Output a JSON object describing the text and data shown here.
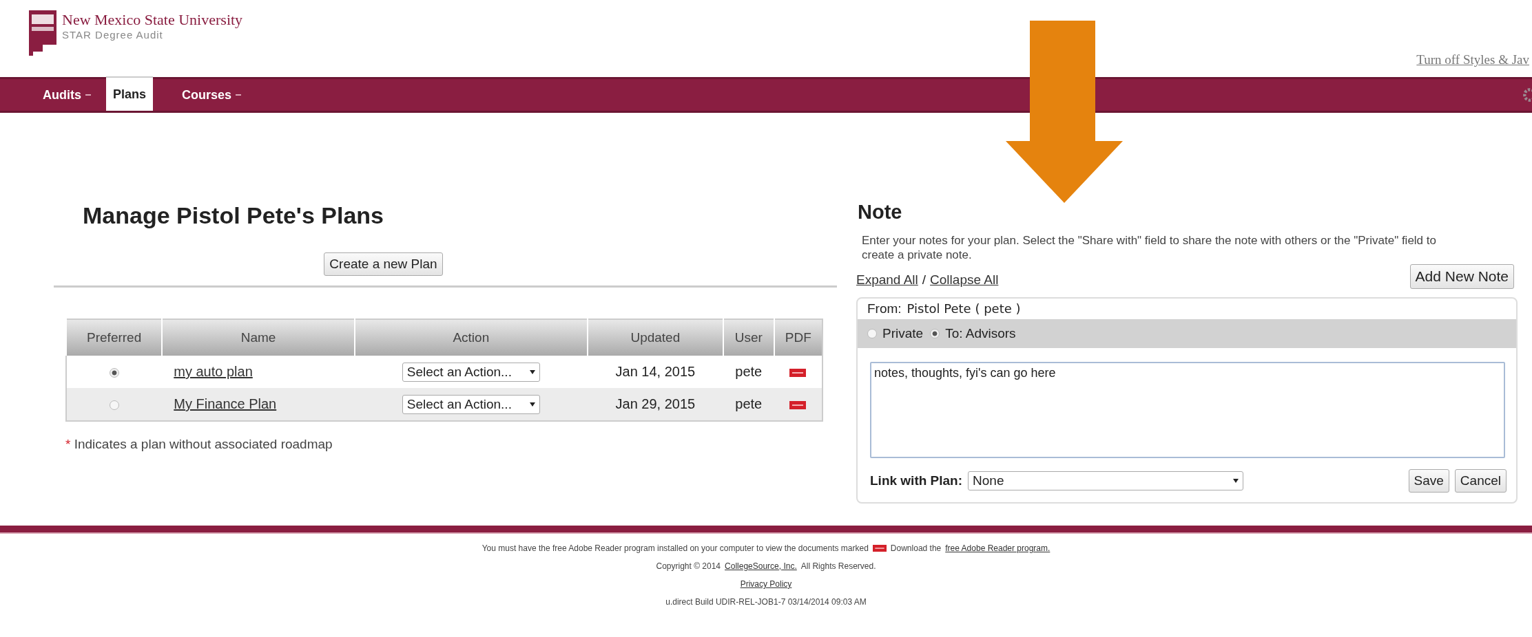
{
  "header": {
    "university": "New Mexico State University",
    "app_name": "STAR Degree Audit",
    "styles_link": "Turn off Styles & Jav"
  },
  "nav": [
    {
      "label": "Audits",
      "selected": false,
      "dropdown": true
    },
    {
      "label": "Plans",
      "selected": true,
      "dropdown": false
    },
    {
      "label": "Courses",
      "selected": false,
      "dropdown": true
    }
  ],
  "plans": {
    "title": "Manage Pistol Pete's Plans",
    "create_button": "Create a new Plan",
    "table": {
      "columns": [
        "Preferred",
        "Name",
        "Action",
        "Updated",
        "User",
        "PDF"
      ],
      "rows": [
        {
          "selected": true,
          "name": "my auto plan",
          "action": "Select an Action...",
          "updated": "Jan 14, 2015",
          "user": "pete"
        },
        {
          "selected": false,
          "name": "My Finance Plan",
          "action": "Select an Action...",
          "updated": "Jan 29, 2015",
          "user": "pete"
        }
      ]
    },
    "footnote_mark": "*",
    "footnote": "Indicates a plan without associated roadmap"
  },
  "note": {
    "title": "Note",
    "description": "Enter your notes for your plan. Select the \"Share with\" field to share the note with others or the \"Private\" field to create a private note.",
    "expand_all": "Expand All",
    "separator": "/",
    "collapse_all": "Collapse All",
    "add_button": "Add New Note",
    "from_label": "From:",
    "from_value": "Pistol Pete ( pete  )",
    "visibility": [
      {
        "label": "Private",
        "selected": false
      },
      {
        "label": "To: Advisors",
        "selected": true
      }
    ],
    "text": "notes, thoughts, fyi's can go here",
    "link_label": "Link with Plan:",
    "link_value": "None",
    "save_button": "Save",
    "cancel_button": "Cancel"
  },
  "footer": {
    "reader_text": "You must have the free Adobe Reader program installed on your computer to view the documents marked",
    "download_text": "Download the",
    "reader_link": "free Adobe Reader program.",
    "copyright_text": "Copyright © 2014",
    "company_link": "CollegeSource, Inc.",
    "rights_text": "All Rights Reserved.",
    "privacy_link": "Privacy Policy",
    "build": "u.direct Build UDIR-REL-JOB1-7 03/14/2014 09:03 AM"
  }
}
